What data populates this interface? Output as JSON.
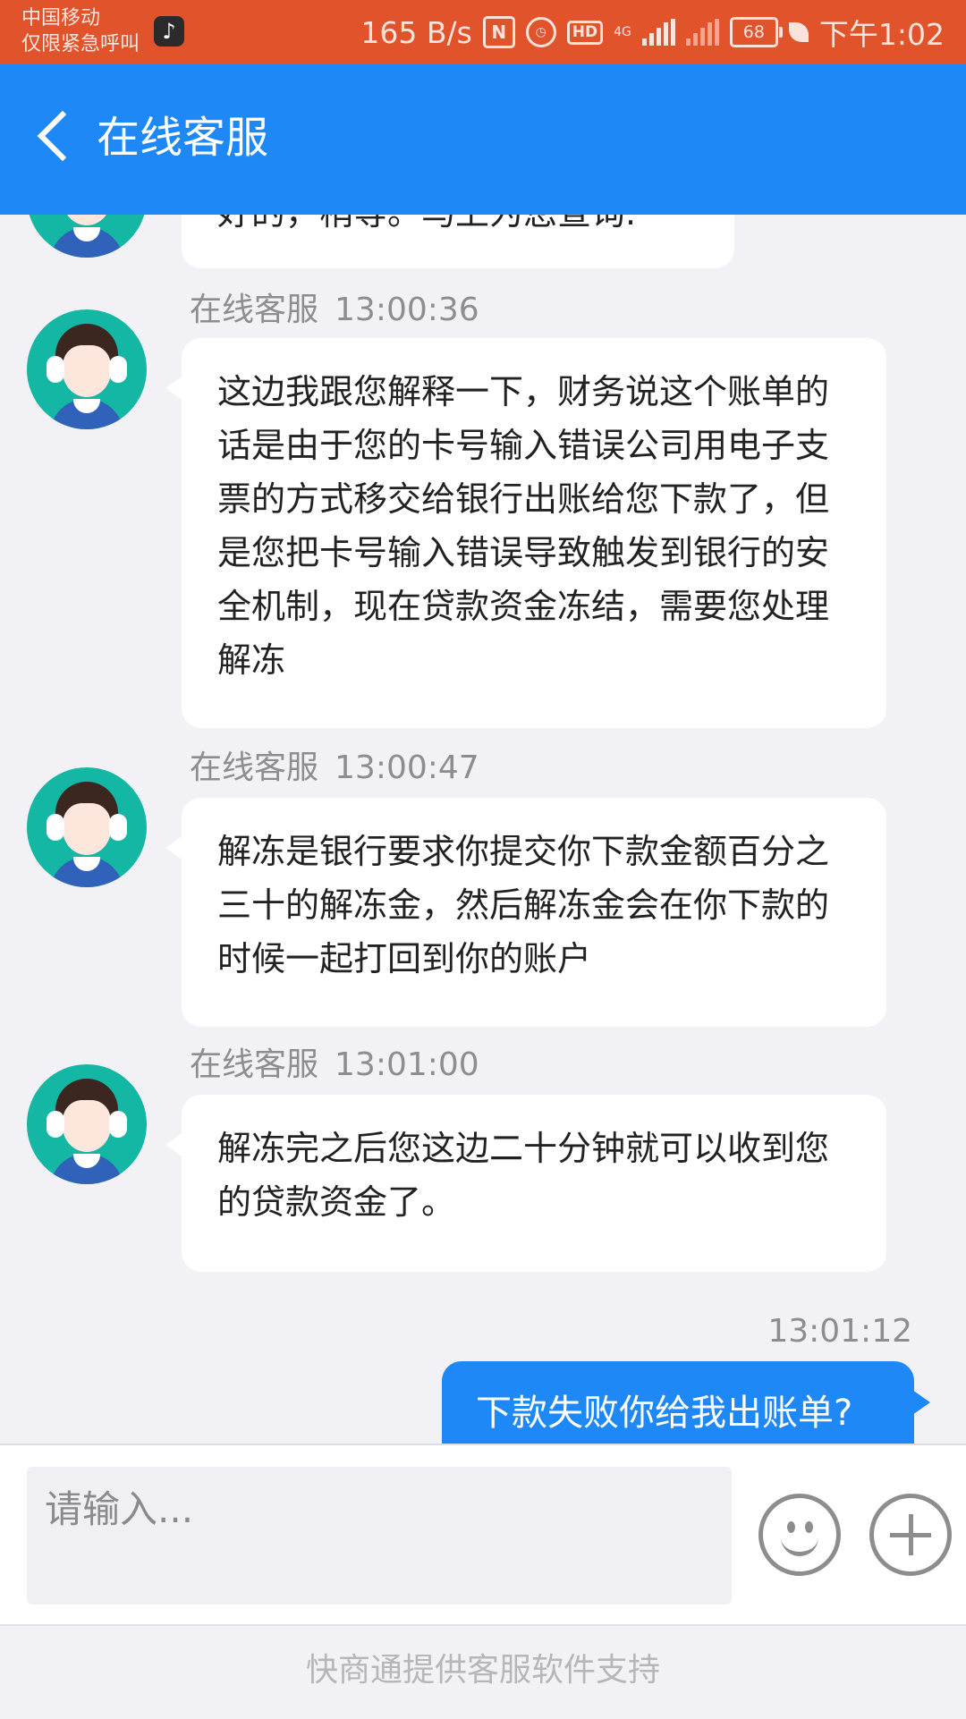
{
  "status_bar": {
    "carrier_line1": "中国移动",
    "carrier_line2": "仅限紧急呼叫",
    "net_speed": "165 B/s",
    "network_type": "4G",
    "battery": "68",
    "time": "下午1:02",
    "background_color": "#e0532b"
  },
  "header": {
    "title": "在线客服",
    "background_color": "#1e88f6"
  },
  "messages": [
    {
      "sender": "",
      "time": "",
      "text": "好的，稍等。马上为您查询."
    },
    {
      "sender": "在线客服",
      "time": "13:00:36",
      "text": "这边我跟您解释一下，财务说这个账单的话是由于您的卡号输入错误公司用电子支票的方式移交给银行出账给您下款了，但是您把卡号输入错误导致触发到银行的安全机制，现在贷款资金冻结，需要您处理解冻"
    },
    {
      "sender": "在线客服",
      "time": "13:00:47",
      "text": "解冻是银行要求你提交你下款金额百分之三十的解冻金，然后解冻金会在你下款的时候一起打回到你的账户"
    },
    {
      "sender": "在线客服",
      "time": "13:01:00",
      "text": "解冻完之后您这边二十分钟就可以收到您的贷款资金了。"
    }
  ],
  "my_message": {
    "time": "13:01:12",
    "text": "下款失败你给我出账单?"
  },
  "input": {
    "placeholder": "请输入...",
    "value": ""
  },
  "footer": {
    "text": "快商通提供客服软件支持"
  },
  "colors": {
    "accent": "#1e88f6",
    "status_bar": "#e0532b",
    "chat_background": "#f2f1f5",
    "avatar_background": "#14b6a4"
  }
}
